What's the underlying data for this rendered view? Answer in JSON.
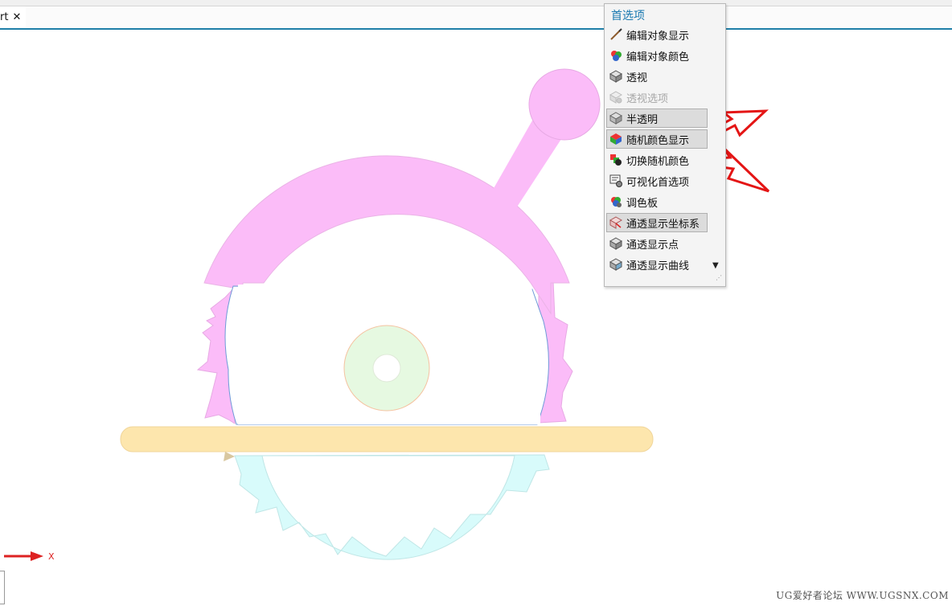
{
  "document_tab": {
    "title": "rt",
    "close_glyph": "✕"
  },
  "axis": {
    "x_label": "X"
  },
  "watermark": "UG爱好者论坛 WWW.UGSNX.COM",
  "menu": {
    "title": "首选项",
    "items": [
      {
        "label": "编辑对象显示",
        "icon": "brush-icon"
      },
      {
        "label": "编辑对象颜色",
        "icon": "color-palette-icon"
      },
      {
        "label": "透视",
        "icon": "cube-icon"
      },
      {
        "label": "透视选项",
        "icon": "cube-options-icon",
        "disabled": true
      },
      {
        "label": "半透明",
        "icon": "translucent-cube-icon",
        "highlighted": true
      },
      {
        "label": "随机颜色显示",
        "icon": "random-color-icon",
        "highlighted": true
      },
      {
        "label": "切换随机颜色",
        "icon": "toggle-random-color-icon"
      },
      {
        "label": "可视化首选项",
        "icon": "visualization-prefs-icon"
      },
      {
        "label": "调色板",
        "icon": "palette-icon"
      },
      {
        "label": "通透显示坐标系",
        "icon": "csys-cube-icon",
        "highlighted": true
      },
      {
        "label": "通透显示点",
        "icon": "point-cube-icon"
      },
      {
        "label": "通透显示曲线",
        "icon": "curve-cube-icon"
      }
    ]
  },
  "colors": {
    "guard": "#fbbcf8",
    "blade": "#d8fbfb",
    "hub": "#e6f9e1",
    "table_bar": "#fde6ad",
    "accent": "#1f7fa8",
    "arrow": "#e41515"
  }
}
